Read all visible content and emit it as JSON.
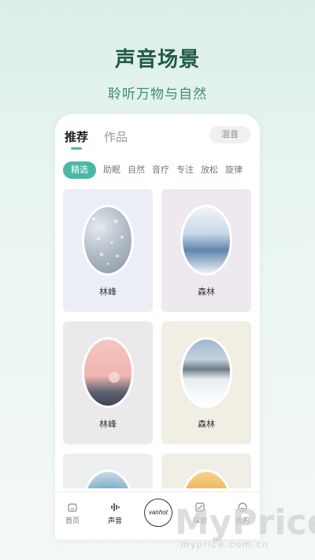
{
  "hero": {
    "title": "声音场景",
    "subtitle": "聆听万物与自然"
  },
  "header": {
    "tabs": [
      {
        "label": "推荐",
        "active": true
      },
      {
        "label": "作品",
        "active": false
      }
    ],
    "mix_button": "混音"
  },
  "chips": [
    "精选",
    "助眠",
    "自然",
    "音疗",
    "专注",
    "放松",
    "旋律"
  ],
  "selected_chip": "精选",
  "cards": [
    {
      "label": "林峰",
      "theme": "rainy-glass",
      "bg": "#ebeef4"
    },
    {
      "label": "森林",
      "theme": "misty-mountains",
      "bg": "#eee9ee"
    },
    {
      "label": "林峰",
      "theme": "pink-sunset",
      "bg": "#ece9ea"
    },
    {
      "label": "森林",
      "theme": "snowy-peaks",
      "bg": "#f1efe4"
    },
    {
      "label": "",
      "theme": "blue-wave",
      "bg": "#eceef0"
    },
    {
      "label": "",
      "theme": "golden-sunset",
      "bg": "#f0eee7"
    }
  ],
  "bottom_nav": [
    {
      "label": "首页",
      "icon": "home-icon"
    },
    {
      "label": "声音",
      "icon": "waveform-icon",
      "active": true
    },
    {
      "label": "vanhot",
      "icon": "center-logo"
    },
    {
      "label": "探索",
      "icon": "explore-icon"
    },
    {
      "label": "我的",
      "icon": "profile-icon"
    }
  ],
  "watermark": {
    "text": "MyPrice",
    "url": "myprice.com.cn"
  },
  "colors": {
    "accent": "#4ab8a4",
    "title": "#1f5a47",
    "subtitle": "#3e8c74"
  }
}
